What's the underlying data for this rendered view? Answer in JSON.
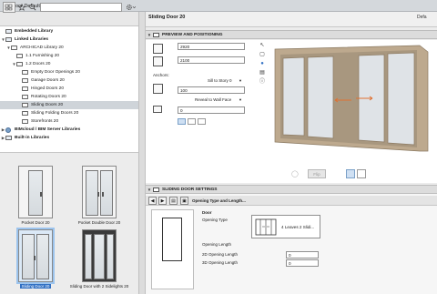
{
  "window": {
    "title": "Door Default Settings"
  },
  "toolbar": {
    "search_placeholder": "",
    "search_value": ""
  },
  "tree": [
    {
      "label": "Embedded Library",
      "level": 1,
      "bold": true,
      "icon": "library-icon"
    },
    {
      "label": "Linked Libraries",
      "level": 0,
      "bold": true,
      "icon": "library-icon",
      "expanded": true
    },
    {
      "label": "ARCHICAD Library 20",
      "level": 1,
      "icon": "folder-icon",
      "expanded": true
    },
    {
      "label": "1.1 Furnishing 20",
      "level": 2,
      "icon": "folder-icon"
    },
    {
      "label": "1.2 Doors 20",
      "level": 2,
      "icon": "folder-icon",
      "expanded": true
    },
    {
      "label": "Empty Door Openings 20",
      "level": 3,
      "icon": "folder-icon"
    },
    {
      "label": "Garage Doors 20",
      "level": 3,
      "icon": "folder-icon"
    },
    {
      "label": "Hinged Doors 20",
      "level": 3,
      "icon": "folder-icon"
    },
    {
      "label": "Rotating Doors 20",
      "level": 3,
      "icon": "folder-icon"
    },
    {
      "label": "Sliding Doors 20",
      "level": 3,
      "icon": "folder-icon",
      "selected": true
    },
    {
      "label": "Sliding Folding Doors 20",
      "level": 3,
      "icon": "folder-icon"
    },
    {
      "label": "Storefronts 20",
      "level": 3,
      "icon": "folder-icon"
    },
    {
      "label": "BIMcloud / BIM Server Libraries",
      "level": 0,
      "bold": true,
      "icon": "bimcloud-icon"
    },
    {
      "label": "Built-in Libraries",
      "level": 0,
      "bold": true,
      "icon": "library-icon"
    }
  ],
  "thumbnails": [
    {
      "label": "Pocket Door 20"
    },
    {
      "label": "Pocket Double Door 20"
    },
    {
      "label": "Sliding Door 20",
      "selected": true
    },
    {
      "label": "Sliding Door with 2 Sidelights 20"
    }
  ],
  "header": {
    "door_name": "Sliding Door 20",
    "default_label": "Defa"
  },
  "preview": {
    "section_title": "PREVIEW AND POSITIONING",
    "width_value": "2920",
    "height_value": "2100",
    "anchors_label": "Anchors:",
    "anchor_option": "Sill to Story 0",
    "sill_value": "100",
    "reveal_option": "Reveal to Wall Face",
    "reveal_value": "0",
    "flip_label": "Flip"
  },
  "settings": {
    "section_title": "SLIDING DOOR SETTINGS",
    "page_selector": "Opening Type and Length...",
    "door_heading": "Door",
    "opening_type_label": "Opening Type",
    "opening_type_value": "4 Leaves 2 Slidi...",
    "opening_length_label": "Opening Length",
    "opening_2d_label": "2D Opening Length",
    "opening_2d_value": "0",
    "opening_3d_label": "3D Opening Length",
    "opening_3d_value": "0"
  },
  "colors": {
    "selection": "#2f6fc3",
    "door_frame": "#a8977f",
    "door_glass": "#d9dee2"
  }
}
